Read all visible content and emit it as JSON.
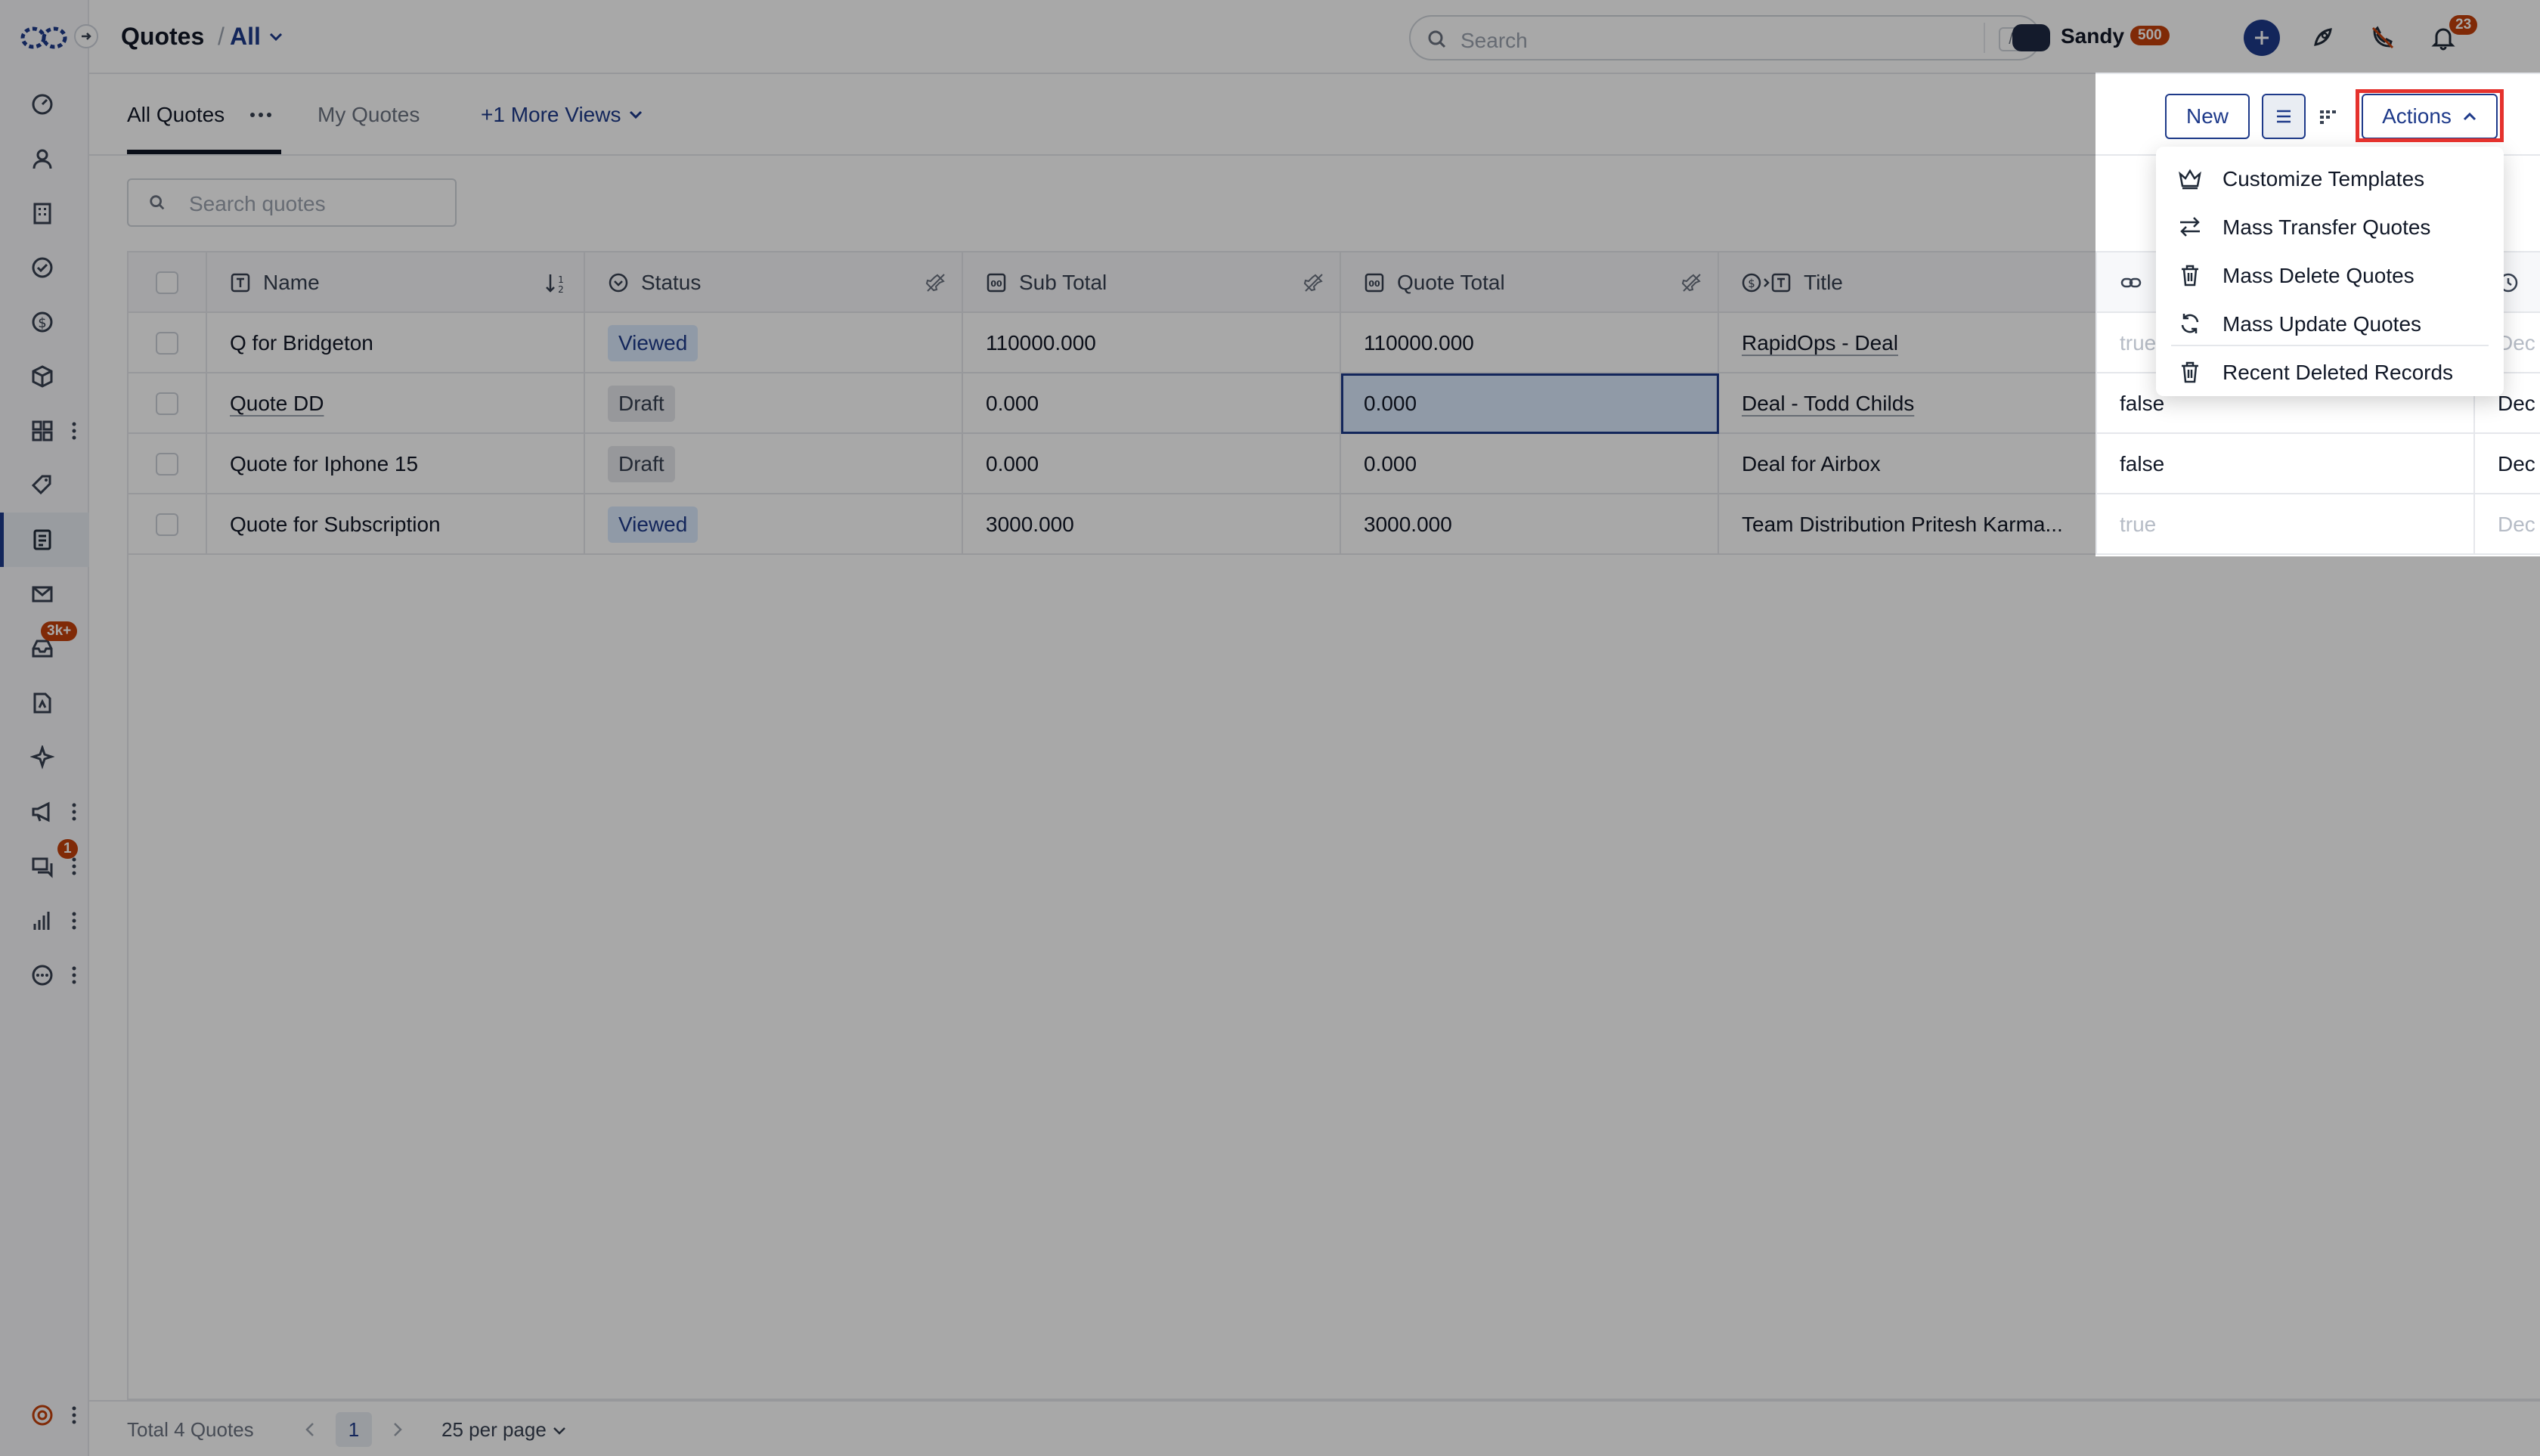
{
  "header": {
    "title": "Quotes",
    "filter": "All",
    "search_placeholder": "Search",
    "search_shortcut": "/",
    "user_name": "Sandy",
    "user_points": "500",
    "notification_count": "23"
  },
  "sidebar": {
    "inbox_badge": "3k+",
    "chat_badge": "1"
  },
  "tabs": [
    {
      "label": "All Quotes"
    },
    {
      "label": "My Quotes"
    },
    {
      "label": "+1 More Views"
    }
  ],
  "toolbar": {
    "new_label": "New",
    "actions_label": "Actions"
  },
  "content": {
    "search_placeholder": "Search quotes"
  },
  "table": {
    "columns": [
      "Name",
      "Status",
      "Sub Total",
      "Quote Total",
      "Title"
    ],
    "rows": [
      {
        "name": "Q for Bridgeton",
        "status": "Viewed",
        "sub_total": "110000.000",
        "quote_total": "110000.000",
        "title": "RapidOps - Deal",
        "flag": "true",
        "extra": "Dec"
      },
      {
        "name": "Quote DD",
        "status": "Draft",
        "sub_total": "0.000",
        "quote_total": "0.000",
        "title": "Deal - Todd Childs",
        "flag": "false",
        "extra": "Dec"
      },
      {
        "name": "Quote for Iphone 15",
        "status": "Draft",
        "sub_total": "0.000",
        "quote_total": "0.000",
        "title": "Deal for Airbox",
        "flag": "false",
        "extra": "Dec"
      },
      {
        "name": "Quote for Subscription",
        "status": "Viewed",
        "sub_total": "3000.000",
        "quote_total": "3000.000",
        "title": "Team Distribution Pritesh Karma...",
        "flag": "true",
        "extra": "Dec"
      }
    ]
  },
  "actions_menu": {
    "items": [
      {
        "label": "Customize Templates",
        "icon": "crown-icon"
      },
      {
        "label": "Mass Transfer Quotes",
        "icon": "transfer-icon"
      },
      {
        "label": "Mass Delete Quotes",
        "icon": "trash-icon"
      },
      {
        "label": "Mass Update Quotes",
        "icon": "refresh-icon"
      },
      {
        "label": "Recent Deleted Records",
        "icon": "trash-icon"
      }
    ]
  },
  "footer": {
    "total": "Total 4 Quotes",
    "page": "1",
    "per_page": "25 per page"
  },
  "colors": {
    "accent": "#1e3a8a",
    "badge": "#c2410c",
    "highlight": "#e5322d"
  }
}
